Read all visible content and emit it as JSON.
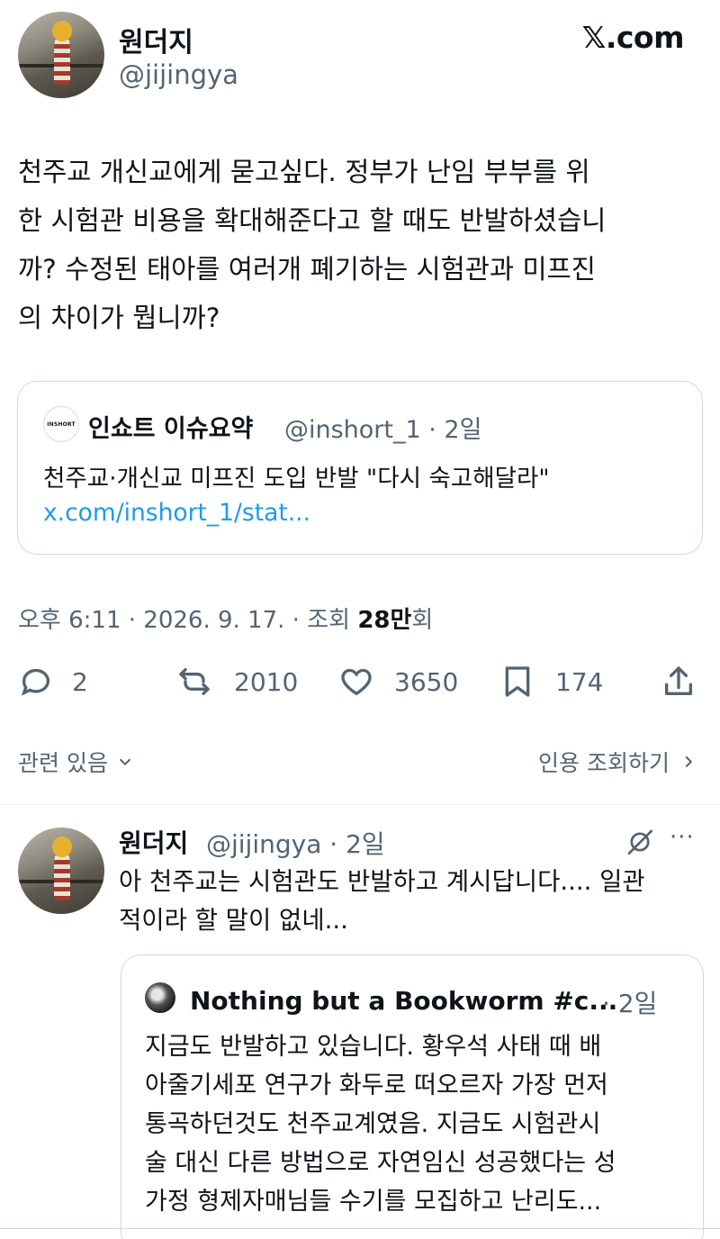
{
  "header": {
    "name": "원더지",
    "handle": "@jijingya",
    "brand": "𝕏.com"
  },
  "tweet": {
    "text_lines": [
      "천주교 개신교에게 묻고싶다. 정부가 난임 부부를 위",
      "한 시험관 비용을 확대해준다고 할 때도 반발하셨습니",
      "까? 수정된 태아를 여러개 폐기하는 시험관과 미프진",
      "의 차이가 뭡니까?"
    ]
  },
  "quote": {
    "logo_text": "INSHORT",
    "name": "인쇼트 이슈요약",
    "handle_time": "@inshort_1 · 2일",
    "text": "천주교·개신교 미프진 도입 반발 \"다시 숙고해달라\"",
    "link": "x.com/inshort_1/stat..."
  },
  "meta": {
    "time": "오후 6:11 · 2026. 9. 17. · 조회 ",
    "views": "28만",
    "views_suffix": "회"
  },
  "actions": {
    "replies": "2",
    "retweets": "2010",
    "likes": "3650",
    "bookmarks": "174"
  },
  "related": {
    "left": "관련 있음",
    "right": "인용 조회하기"
  },
  "reply": {
    "name": "원더지",
    "handle_time": "@jijingya · 2일",
    "text_lines": [
      "아 천주교는 시험관도 반발하고 계시답니다.... 일관",
      "적이라 할 말이 없네..."
    ],
    "more": "···",
    "quote": {
      "name": "Nothing but a Bookworm #c...",
      "time": " · 2일",
      "text_lines": [
        "지금도 반발하고 있습니다. 황우석 사태 때 배",
        "아줄기세포 연구가 화두로 떠오르자 가장 먼저",
        "통곡하던것도 천주교계였음. 지금도 시험관시",
        "술 대신 다른 방법으로 자연임신 성공했다는 성",
        "가정 형제자매님들 수기를 모집하고 난리도..."
      ]
    }
  },
  "colors": {
    "text": "#0f1419",
    "secondary": "#536471",
    "link": "#1d9bf0",
    "border": "#cfd9de"
  }
}
